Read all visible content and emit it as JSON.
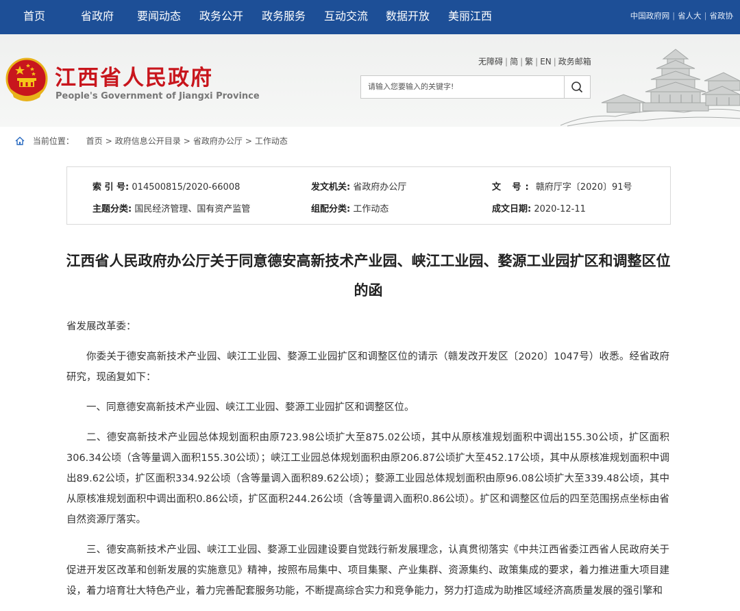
{
  "top_nav": {
    "items": [
      "首页",
      "省政府",
      "要闻动态",
      "政务公开",
      "政务服务",
      "互动交流",
      "数据开放",
      "美丽江西"
    ],
    "right_links": [
      "中国政府网",
      "省人大",
      "省政协"
    ]
  },
  "header": {
    "brand_cn": "江西省人民政府",
    "brand_en": "People's Government of Jiangxi Province",
    "util_links": [
      "无障碍",
      "简",
      "繁",
      "EN",
      "政务邮箱"
    ],
    "search": {
      "placeholder": "请输入您要输入的关键字!"
    }
  },
  "breadcrumb": {
    "label": "当前位置：",
    "items": [
      "首页",
      "政府信息公开目录",
      "省政府办公厅",
      "工作动态"
    ]
  },
  "info": {
    "index_label": "索 引 号:",
    "index_value": "014500815/2020-66008",
    "issuer_label": "发文机关:",
    "issuer_value": "省政府办公厅",
    "docno_label": "文 号:",
    "docno_value": "赣府厅字〔2020〕91号",
    "topic_label": "主题分类:",
    "topic_value": "国民经济管理、国有资产监管",
    "group_label": "组配分类:",
    "group_value": "工作动态",
    "date_label": "成文日期:",
    "date_value": "2020-12-11"
  },
  "article": {
    "title": "江西省人民政府办公厅关于同意德安高新技术产业园、峡江工业园、婺源工业园扩区和调整区位的函",
    "salutation": "省发展改革委：",
    "paragraphs": [
      "你委关于德安高新技术产业园、峡江工业园、婺源工业园扩区和调整区位的请示（赣发改开发区〔2020〕1047号）收悉。经省政府研究，现函复如下：",
      "一、同意德安高新技术产业园、峡江工业园、婺源工业园扩区和调整区位。",
      "二、德安高新技术产业园总体规划面积由原723.98公顷扩大至875.02公顷，其中从原核准规划面积中调出155.30公顷，扩区面积306.34公顷（含等量调入面积155.30公顷）；峡江工业园总体规划面积由原206.87公顷扩大至452.17公顷，其中从原核准规划面积中调出89.62公顷，扩区面积334.92公顷（含等量调入面积89.62公顷）；婺源工业园总体规划面积由原96.08公顷扩大至339.48公顷，其中从原核准规划面积中调出面积0.86公顷，扩区面积244.26公顷（含等量调入面积0.86公顷）。扩区和调整区位后的四至范围拐点坐标由省自然资源厅落实。",
      "三、德安高新技术产业园、峡江工业园、婺源工业园建设要自觉践行新发展理念，认真贯彻落实《中共江西省委江西省人民政府关于促进开发区改革和创新发展的实施意见》精神，按照布局集中、项目集聚、产业集群、资源集约、政策集成的要求，着力推进重大项目建设，着力培育壮大特色产业，着力完善配套服务功能，不断提高综合实力和竞争能力，努力打造成为助推区域经济高质量发展的强引擎和"
    ]
  },
  "colors": {
    "nav_bg": "#1d4f97",
    "brand_red": "#c8161d"
  },
  "icons": [
    "emblem-icon",
    "search-icon",
    "home-icon",
    "pavilion-image"
  ]
}
